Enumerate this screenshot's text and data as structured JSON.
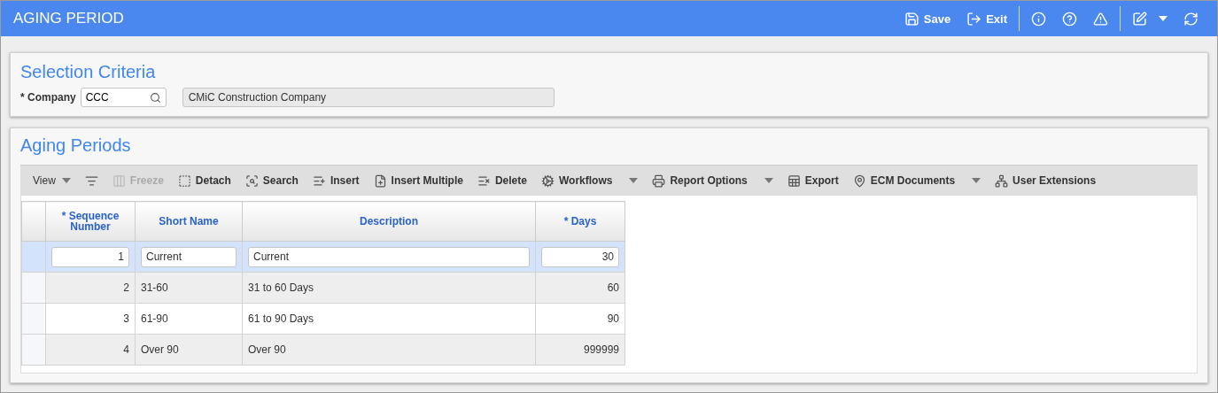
{
  "header": {
    "title": "AGING PERIOD",
    "actions": [
      {
        "kind": "save",
        "label": "Save"
      },
      {
        "kind": "exit",
        "label": "Exit"
      },
      {
        "kind": "info"
      },
      {
        "kind": "help"
      },
      {
        "kind": "warning"
      },
      {
        "kind": "edit",
        "dropdown": true
      },
      {
        "kind": "refresh"
      }
    ]
  },
  "selection": {
    "title": "Selection Criteria",
    "company": {
      "label": "* Company",
      "value": "CCC",
      "name": "CMiC Construction Company"
    }
  },
  "aging": {
    "title": "Aging Periods",
    "toolbar": [
      {
        "kind": "view",
        "label": "View",
        "dropdown": true,
        "disabled": false
      },
      {
        "kind": "filter",
        "disabled": false,
        "dropdown": false
      },
      {
        "kind": "freeze",
        "label": "Freeze",
        "disabled": true,
        "dropdown": false
      },
      {
        "kind": "detach",
        "label": "Detach",
        "disabled": false,
        "dropdown": false
      },
      {
        "kind": "search",
        "label": "Search",
        "disabled": false,
        "dropdown": false
      },
      {
        "kind": "insert",
        "label": "Insert",
        "disabled": false,
        "dropdown": false
      },
      {
        "kind": "insert-multiple",
        "label": "Insert Multiple",
        "disabled": false,
        "dropdown": false
      },
      {
        "kind": "delete",
        "label": "Delete",
        "disabled": false,
        "dropdown": false
      },
      {
        "kind": "workflows",
        "label": "Workflows",
        "disabled": false,
        "dropdown": true
      },
      {
        "kind": "report",
        "label": "Report Options",
        "disabled": false,
        "dropdown": true
      },
      {
        "kind": "export",
        "label": "Export",
        "disabled": false,
        "dropdown": false
      },
      {
        "kind": "ecm",
        "label": "ECM Documents",
        "disabled": false,
        "dropdown": true
      },
      {
        "kind": "extensions",
        "label": "User Extensions",
        "disabled": false,
        "dropdown": false
      }
    ],
    "columns": [
      "* Sequence Number",
      "Short Name",
      "Description",
      "* Days"
    ],
    "rows": [
      {
        "selected": true,
        "cells": [
          "1",
          "Current",
          "Current",
          "30"
        ]
      },
      {
        "selected": false,
        "cells": [
          "2",
          "31-60",
          "31 to 60 Days",
          "60"
        ]
      },
      {
        "selected": false,
        "cells": [
          "3",
          "61-90",
          "61 to 90 Days",
          "90"
        ]
      },
      {
        "selected": false,
        "cells": [
          "4",
          "Over 90",
          "Over 90",
          "999999"
        ]
      }
    ]
  }
}
